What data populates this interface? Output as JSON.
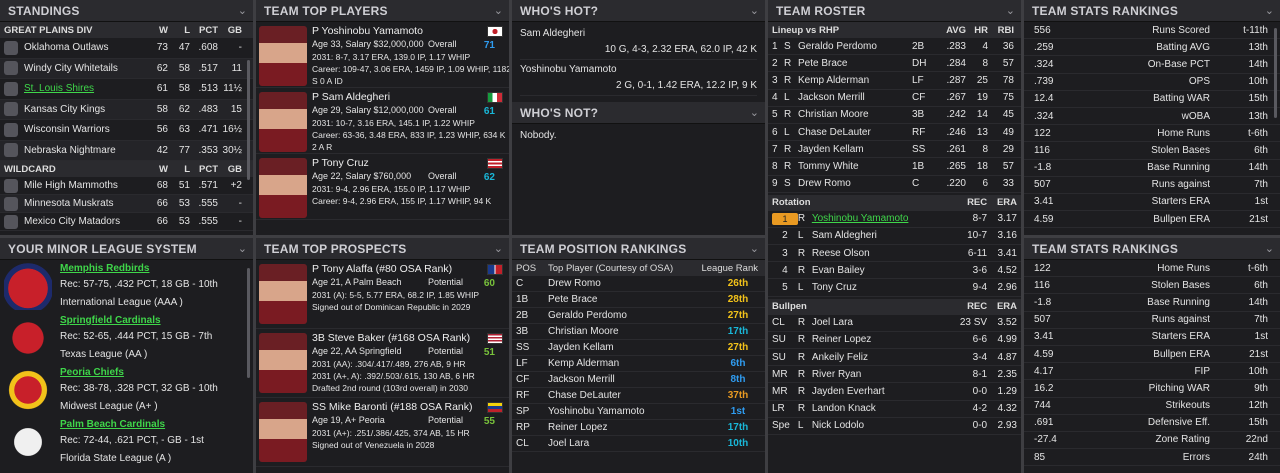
{
  "standings": {
    "title": "STANDINGS",
    "div": "GREAT PLAINS DIV",
    "cols": [
      "W",
      "L",
      "PCT",
      "GB"
    ],
    "teams": [
      {
        "name": "Oklahoma Outlaws",
        "w": "73",
        "l": "47",
        "pct": ".608",
        "gb": "-",
        "link": false
      },
      {
        "name": "Windy City Whitetails",
        "w": "62",
        "l": "58",
        "pct": ".517",
        "gb": "11",
        "link": false
      },
      {
        "name": "St. Louis Shires",
        "w": "61",
        "l": "58",
        "pct": ".513",
        "gb": "11½",
        "link": true
      },
      {
        "name": "Kansas City Kings",
        "w": "58",
        "l": "62",
        "pct": ".483",
        "gb": "15",
        "link": false
      },
      {
        "name": "Wisconsin Warriors",
        "w": "56",
        "l": "63",
        "pct": ".471",
        "gb": "16½",
        "link": false
      },
      {
        "name": "Nebraska Nightmare",
        "w": "42",
        "l": "77",
        "pct": ".353",
        "gb": "30½",
        "link": false
      }
    ],
    "wild": "WILDCARD",
    "wildteams": [
      {
        "name": "Mile High Mammoths",
        "w": "68",
        "l": "51",
        "pct": ".571",
        "gb": "+2"
      },
      {
        "name": "Minnesota Muskrats",
        "w": "66",
        "l": "53",
        "pct": ".555",
        "gb": "-"
      },
      {
        "name": "Mexico City Matadors",
        "w": "66",
        "l": "53",
        "pct": ".555",
        "gb": "-"
      }
    ]
  },
  "topplayers": {
    "title": "TEAM TOP PLAYERS",
    "players": [
      {
        "name": "P Yoshinobu Yamamoto",
        "info": "Age 33, Salary $32,000,000",
        "ovl": "Overall",
        "rating": "71",
        "l1": "2031: 8-7, 3.17 ERA, 139.0 IP, 1.17 WHIP",
        "l2": "Career: 109-47, 3.06 ERA, 1459 IP, 1.09 WHIP, 1182",
        "l3": "S 0 A ID",
        "flag": "jp",
        "rc": "c-blu"
      },
      {
        "name": "P Sam Aldegheri",
        "info": "Age 29, Salary $12,000,000",
        "ovl": "Overall",
        "rating": "61",
        "l1": "2031: 10-7, 3.16 ERA, 145.1 IP, 1.22 WHIP",
        "l2": "Career: 63-36, 3.48 ERA, 833 IP, 1.23 WHIP, 634 K",
        "l3": "2 A R",
        "flag": "it",
        "rc": "c-cyan"
      },
      {
        "name": "P Tony Cruz",
        "info": "Age 22, Salary $760,000",
        "ovl": "Overall",
        "rating": "62",
        "l1": "2031: 9-4, 2.96 ERA, 155.0 IP, 1.17 WHIP",
        "l2": "Career: 9-4, 2.96 ERA, 155 IP, 1.17 WHIP, 94 K",
        "l3": "",
        "flag": "pr",
        "rc": "c-cyan"
      }
    ]
  },
  "hot": {
    "title": "WHO'S HOT?",
    "items": [
      {
        "name": "Sam Aldegheri",
        "line": "10 G, 4-3, 2.32 ERA, 62.0 IP, 42 K"
      },
      {
        "name": "Yoshinobu Yamamoto",
        "line": "2 G, 0-1, 1.42 ERA, 12.2 IP, 9 K"
      }
    ],
    "nottitle": "WHO'S NOT?",
    "nottext": "Nobody."
  },
  "roster": {
    "title": "TEAM ROSTER",
    "lineup_hdr": "Lineup vs RHP",
    "cols": [
      "AVG",
      "HR",
      "RBI"
    ],
    "lineup": [
      {
        "n": "1",
        "h": "S",
        "name": "Geraldo Perdomo",
        "pos": "2B",
        "avg": ".283",
        "hr": "4",
        "rbi": "36"
      },
      {
        "n": "2",
        "h": "R",
        "name": "Pete Brace",
        "pos": "DH",
        "avg": ".284",
        "hr": "8",
        "rbi": "57"
      },
      {
        "n": "3",
        "h": "R",
        "name": "Kemp Alderman",
        "pos": "LF",
        "avg": ".287",
        "hr": "25",
        "rbi": "78"
      },
      {
        "n": "4",
        "h": "L",
        "name": "Jackson Merrill",
        "pos": "CF",
        "avg": ".267",
        "hr": "19",
        "rbi": "75"
      },
      {
        "n": "5",
        "h": "R",
        "name": "Christian Moore",
        "pos": "3B",
        "avg": ".242",
        "hr": "14",
        "rbi": "45"
      },
      {
        "n": "6",
        "h": "L",
        "name": "Chase DeLauter",
        "pos": "RF",
        "avg": ".246",
        "hr": "13",
        "rbi": "49"
      },
      {
        "n": "7",
        "h": "R",
        "name": "Jayden Kellam",
        "pos": "SS",
        "avg": ".261",
        "hr": "8",
        "rbi": "29"
      },
      {
        "n": "8",
        "h": "R",
        "name": "Tommy White",
        "pos": "1B",
        "avg": ".265",
        "hr": "18",
        "rbi": "57"
      },
      {
        "n": "9",
        "h": "S",
        "name": "Drew Romo",
        "pos": "C",
        "avg": ".220",
        "hr": "6",
        "rbi": "33"
      }
    ],
    "rot_hdr": "Rotation",
    "rot_cols": [
      "REC",
      "ERA"
    ],
    "rotation": [
      {
        "n": "1",
        "h": "R",
        "name": "Yoshinobu Yamamoto",
        "rec": "8-7",
        "era": "3.17"
      },
      {
        "n": "2",
        "h": "L",
        "name": "Sam Aldegheri",
        "rec": "10-7",
        "era": "3.16"
      },
      {
        "n": "3",
        "h": "R",
        "name": "Reese Olson",
        "rec": "6-11",
        "era": "3.41"
      },
      {
        "n": "4",
        "h": "R",
        "name": "Evan Bailey",
        "rec": "3-6",
        "era": "4.52"
      },
      {
        "n": "5",
        "h": "L",
        "name": "Tony Cruz",
        "rec": "9-4",
        "era": "2.96"
      }
    ],
    "bp_hdr": "Bullpen",
    "bp_cols": [
      "REC",
      "ERA"
    ],
    "bullpen": [
      {
        "n": "CL",
        "h": "R",
        "name": "Joel Lara",
        "rec": "23 SV",
        "era": "3.52"
      },
      {
        "n": "SU",
        "h": "R",
        "name": "Reiner Lopez",
        "rec": "6-6",
        "era": "4.99"
      },
      {
        "n": "SU",
        "h": "R",
        "name": "Ankeily Feliz",
        "rec": "3-4",
        "era": "4.87"
      },
      {
        "n": "MR",
        "h": "R",
        "name": "River Ryan",
        "rec": "8-1",
        "era": "2.35"
      },
      {
        "n": "MR",
        "h": "R",
        "name": "Jayden Everhart",
        "rec": "0-0",
        "era": "1.29"
      },
      {
        "n": "LR",
        "h": "R",
        "name": "Landon Knack",
        "rec": "4-2",
        "era": "4.32"
      },
      {
        "n": "Spe",
        "h": "L",
        "name": "Nick Lodolo",
        "rec": "0-0",
        "era": "2.93"
      }
    ]
  },
  "stats1": {
    "title": "TEAM STATS RANKINGS",
    "rows": [
      {
        "v": "556",
        "s": "Runs Scored",
        "r": "t-11th"
      },
      {
        "v": ".259",
        "s": "Batting AVG",
        "r": "13th"
      },
      {
        "v": ".324",
        "s": "On-Base PCT",
        "r": "14th"
      },
      {
        "v": ".739",
        "s": "OPS",
        "r": "10th"
      },
      {
        "v": "12.4",
        "s": "Batting WAR",
        "r": "15th"
      },
      {
        "v": ".324",
        "s": "wOBA",
        "r": "13th"
      },
      {
        "v": "122",
        "s": "Home Runs",
        "r": "t-6th"
      },
      {
        "v": "116",
        "s": "Stolen Bases",
        "r": "6th"
      },
      {
        "v": "-1.8",
        "s": "Base Running",
        "r": "14th"
      },
      {
        "v": "507",
        "s": "Runs against",
        "r": "7th"
      },
      {
        "v": "3.41",
        "s": "Starters ERA",
        "r": "1st"
      },
      {
        "v": "4.59",
        "s": "Bullpen ERA",
        "r": "21st"
      }
    ]
  },
  "minors": {
    "title": "YOUR MINOR LEAGUE SYSTEM",
    "teams": [
      {
        "name": "Memphis Redbirds",
        "rec": "Rec: 57-75, .432 PCT, 18 GB - 10th",
        "lg": "International League (AAA )"
      },
      {
        "name": "Springfield Cardinals",
        "rec": "Rec: 52-65, .444 PCT, 15 GB - 7th",
        "lg": "Texas League (AA )"
      },
      {
        "name": "Peoria Chiefs",
        "rec": "Rec: 38-78, .328 PCT, 32 GB - 10th",
        "lg": "Midwest League (A+ )"
      },
      {
        "name": "Palm Beach Cardinals",
        "rec": "Rec: 72-44, .621 PCT, - GB - 1st",
        "lg": "Florida State League (A )"
      }
    ]
  },
  "prospects": {
    "title": "TEAM TOP PROSPECTS",
    "list": [
      {
        "name": "P Tony Alaffa (#80 OSA Rank)",
        "info": "Age 21, A Palm Beach",
        "pot": "Potential",
        "rating": "60",
        "l1": "2031 (A): 5-5, 5.77 ERA, 68.2 IP, 1.85 WHIP",
        "l2": "Signed out of Dominican Republic in 2029",
        "l3": "",
        "flag": "do"
      },
      {
        "name": "3B Steve Baker (#168 OSA Rank)",
        "info": "Age 22, AA Springfield",
        "pot": "Potential",
        "rating": "51",
        "l1": "2031 (AA): .304/.417/.489, 276 AB, 9 HR",
        "l2": "2031 (A+, A): .392/.503/.615, 130 AB, 6 HR",
        "l3": "Drafted 2nd round (103rd overall) in 2030",
        "flag": "us"
      },
      {
        "name": "SS Mike Baronti (#188 OSA Rank)",
        "info": "Age 19, A+ Peoria",
        "pot": "Potential",
        "rating": "55",
        "l1": "2031 (A+): .251/.386/.425, 374 AB, 15 HR",
        "l2": "Signed out of Venezuela in 2028",
        "l3": "",
        "flag": "ve"
      }
    ]
  },
  "posrank": {
    "title": "TEAM POSITION RANKINGS",
    "cols": [
      "POS",
      "Top Player (Courtesy of OSA)",
      "League Rank"
    ],
    "rows": [
      {
        "pos": "C",
        "p": "Drew Romo",
        "r": "26th",
        "c": "c-yel"
      },
      {
        "pos": "1B",
        "p": "Pete Brace",
        "r": "28th",
        "c": "c-yel"
      },
      {
        "pos": "2B",
        "p": "Geraldo Perdomo",
        "r": "27th",
        "c": "c-yel"
      },
      {
        "pos": "3B",
        "p": "Christian Moore",
        "r": "17th",
        "c": "c-cyan"
      },
      {
        "pos": "SS",
        "p": "Jayden Kellam",
        "r": "27th",
        "c": "c-yel"
      },
      {
        "pos": "LF",
        "p": "Kemp Alderman",
        "r": "6th",
        "c": "c-blu"
      },
      {
        "pos": "CF",
        "p": "Jackson Merrill",
        "r": "8th",
        "c": "c-blu"
      },
      {
        "pos": "RF",
        "p": "Chase DeLauter",
        "r": "37th",
        "c": "c-org"
      },
      {
        "pos": "SP",
        "p": "Yoshinobu Yamamoto",
        "r": "1st",
        "c": "c-blu"
      },
      {
        "pos": "RP",
        "p": "Reiner Lopez",
        "r": "17th",
        "c": "c-cyan"
      },
      {
        "pos": "CL",
        "p": "Joel Lara",
        "r": "10th",
        "c": "c-cyan"
      }
    ]
  },
  "stats2": {
    "title": "TEAM STATS RANKINGS",
    "rows": [
      {
        "v": "122",
        "s": "Home Runs",
        "r": "t-6th"
      },
      {
        "v": "116",
        "s": "Stolen Bases",
        "r": "6th"
      },
      {
        "v": "-1.8",
        "s": "Base Running",
        "r": "14th"
      },
      {
        "v": "507",
        "s": "Runs against",
        "r": "7th"
      },
      {
        "v": "3.41",
        "s": "Starters ERA",
        "r": "1st"
      },
      {
        "v": "4.59",
        "s": "Bullpen ERA",
        "r": "21st"
      },
      {
        "v": "4.17",
        "s": "FIP",
        "r": "10th"
      },
      {
        "v": "16.2",
        "s": "Pitching WAR",
        "r": "9th"
      },
      {
        "v": "744",
        "s": "Strikeouts",
        "r": "12th"
      },
      {
        "v": ".691",
        "s": "Defensive Eff.",
        "r": "15th"
      },
      {
        "v": "-27.4",
        "s": "Zone Rating",
        "r": "22nd"
      },
      {
        "v": "85",
        "s": "Errors",
        "r": "24th"
      }
    ]
  },
  "chevron": "⌄"
}
